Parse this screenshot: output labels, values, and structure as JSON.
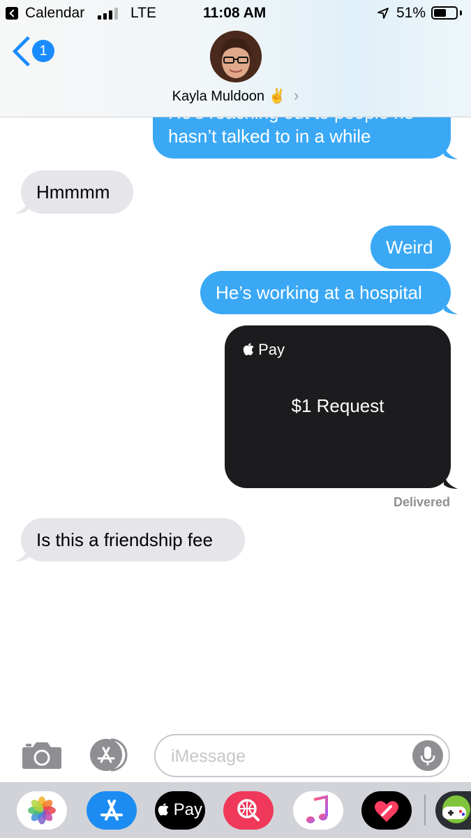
{
  "status_bar": {
    "back_app": "Calendar",
    "network": "LTE",
    "time": "11:08 AM",
    "battery_percent": "51%",
    "battery_level": 0.51,
    "signal_bars": 3
  },
  "header": {
    "back_badge": "1",
    "contact_name": "Kayla Muldoon",
    "contact_emoji": "✌️",
    "chevron": "›"
  },
  "messages": [
    {
      "type": "sent",
      "text_line1": "He’s reaching out to people he",
      "text_line2": "hasn’t talked to in a while"
    },
    {
      "type": "received",
      "text": "Hmmmm"
    },
    {
      "type": "sent",
      "text": "Weird"
    },
    {
      "type": "sent",
      "text": "He’s working at a hospital"
    },
    {
      "type": "apple_pay",
      "logo": "Pay",
      "text": "$1 Request"
    },
    {
      "type": "status",
      "text": "Delivered"
    },
    {
      "type": "received",
      "text": "Is this a friendship fee"
    }
  ],
  "input_bar": {
    "placeholder": "iMessage"
  },
  "app_drawer": {
    "apps": [
      "photos-app",
      "app-store-app",
      "apple-pay-app",
      "images-search-app",
      "music-app",
      "digital-touch-app",
      "game-app"
    ],
    "apple_pay_label": "Pay"
  },
  "colors": {
    "sent_bubble": "#3aa8f5",
    "received_bubble": "#e5e5ea",
    "accent": "#1a8cff",
    "pay_card": "#1c1c1e"
  }
}
